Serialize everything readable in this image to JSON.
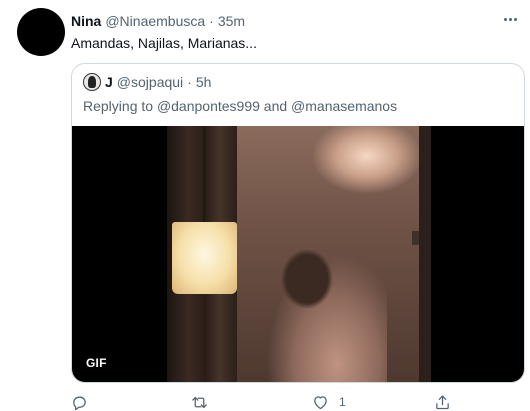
{
  "tweet": {
    "author_name": "Nina",
    "author_handle": "@Ninaembusca",
    "separator": "·",
    "time": "35m",
    "text": "Amandas, Najilas, Marianas..."
  },
  "quote": {
    "author_name": "J",
    "author_handle": "@sojpaqui",
    "separator": "·",
    "time": "5h",
    "replying_prefix": "Replying to",
    "mention_1": "@danpontes999",
    "replying_and": "and",
    "mention_2": "@manasemanos",
    "media_badge": "GIF"
  },
  "actions": {
    "reply_icon": "comment-icon",
    "retweet_icon": "retweet-icon",
    "like_icon": "heart-icon",
    "like_count": "1",
    "share_icon": "share-icon"
  },
  "colors": {
    "text_primary": "#0f1419",
    "text_secondary": "#536471",
    "border": "#cfd9de"
  }
}
